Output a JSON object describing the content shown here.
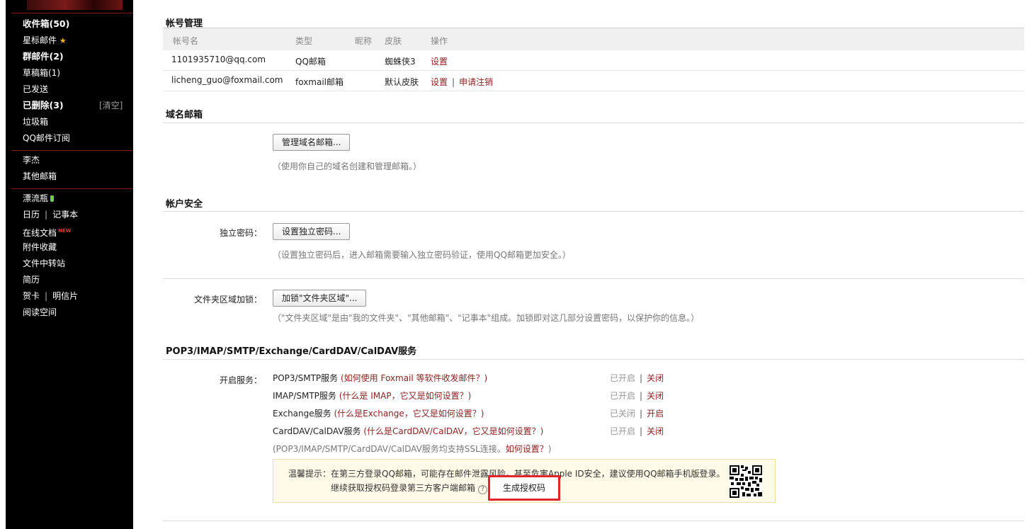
{
  "sidebar": {
    "folders": [
      {
        "label": "收件箱(50)",
        "bold": true
      },
      {
        "label": "星标邮件",
        "bold": false,
        "icon": "star-icon"
      },
      {
        "label": "群邮件(2)",
        "bold": true
      },
      {
        "label": "草稿箱(1)",
        "bold": false
      },
      {
        "label": "已发送",
        "bold": false
      },
      {
        "label": "已删除(3)",
        "bold": true
      },
      {
        "label": "垃圾箱",
        "bold": false
      },
      {
        "label": "QQ邮件订阅",
        "bold": false
      }
    ],
    "clear_label": "[清空]",
    "accounts": [
      "李杰",
      "其他邮箱"
    ],
    "apps": {
      "drift_bottle": "漂流瓶",
      "calendar": "日历",
      "notebook": "记事本",
      "online_docs": "在线文档",
      "new_tag": "NEW",
      "attachments": "附件收藏",
      "file_transfer": "文件中转站",
      "resume": "简历",
      "greeting_card": "贺卡",
      "postcard": "明信片",
      "reading": "阅读空间",
      "pipe": "|"
    }
  },
  "accounts_section": {
    "title": "帐号管理",
    "headers": {
      "name": "帐号名",
      "type": "类型",
      "nickname": "昵称",
      "skin": "皮肤",
      "action": "操作"
    },
    "rows": [
      {
        "name": "1101935710@qq.com",
        "type": "QQ邮箱",
        "skin": "蜘蛛侠3",
        "settings": "设置",
        "cancel": ""
      },
      {
        "name": "licheng_guo@foxmail.com",
        "type": "foxmail邮箱",
        "skin": "默认皮肤",
        "settings": "设置",
        "cancel": "申请注销"
      }
    ],
    "sep": "|"
  },
  "domain_section": {
    "title": "域名邮箱",
    "button": "管理域名邮箱...",
    "hint": "（使用你自己的域名创建和管理邮箱。）"
  },
  "security_section": {
    "title": "帐户安全",
    "pwd_label": "独立密码：",
    "pwd_button": "设置独立密码...",
    "pwd_hint": "（设置独立密码后，进入邮箱需要输入独立密码验证，使用QQ邮箱更加安全。）",
    "folder_label": "文件夹区域加锁：",
    "folder_button": "加锁\"文件夹区域\"...",
    "folder_hint": "（\"文件夹区域\"是由\"我的文件夹\"、\"其他邮箱\"、\"记事本\"组成。加锁即对这几部分设置密码，以保护你的信息。）"
  },
  "services_section": {
    "title": "POP3/IMAP/SMTP/Exchange/CardDAV/CalDAV服务",
    "label": "开启服务：",
    "services": [
      {
        "name": "POP3/SMTP服务",
        "question": "(如何使用 Foxmail 等软件收发邮件？)",
        "state": "已开启",
        "action": "关闭"
      },
      {
        "name": "IMAP/SMTP服务",
        "question": "(什么是 IMAP，它又是如何设置？)",
        "state": "已开启",
        "action": "关闭"
      },
      {
        "name": "Exchange服务",
        "question": "(什么是Exchange，它又是如何设置？)",
        "state": "已关闭",
        "action": "开启"
      },
      {
        "name": "CardDAV/CalDAV服务",
        "question": "(什么是CardDAV/CalDAV，它又是如何设置？)",
        "state": "已开启",
        "action": "关闭"
      }
    ],
    "ssl_hint_prefix": "(POP3/IMAP/SMTP/CardDAV/CalDAV服务均支持SSL连接。",
    "ssl_hint_link": "如何设置？",
    "ssl_hint_suffix": ")",
    "sep": "|",
    "warning_line1": "温馨提示：在第三方登录QQ邮箱，可能存在邮件泄露风险，甚至危害Apple ID安全，建议使用QQ邮箱手机版登录。",
    "warning_line2": "继续获取授权码登录第三方客户端邮箱",
    "qmark": "?",
    "generate_button": "生成授权码"
  },
  "colors": {
    "link": "#8b1f1f",
    "highlight": "#e0262b",
    "sidebar_bg": "#000000"
  }
}
